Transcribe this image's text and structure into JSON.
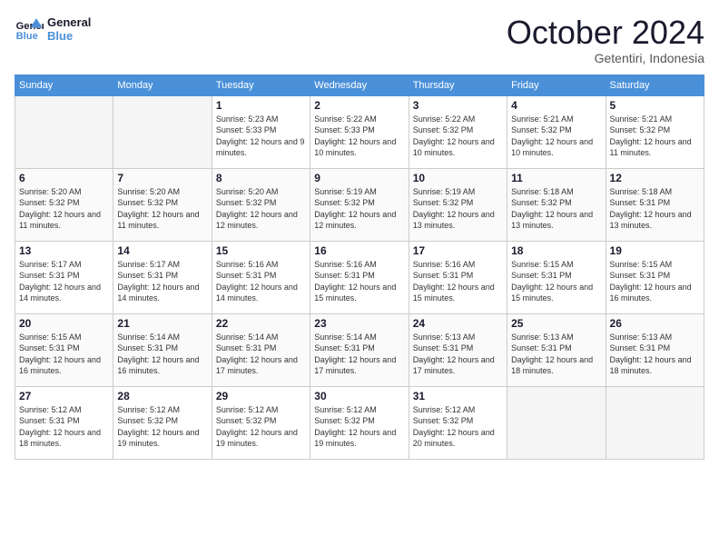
{
  "logo": {
    "text_general": "General",
    "text_blue": "Blue"
  },
  "header": {
    "month": "October 2024",
    "location": "Getentiri, Indonesia"
  },
  "weekdays": [
    "Sunday",
    "Monday",
    "Tuesday",
    "Wednesday",
    "Thursday",
    "Friday",
    "Saturday"
  ],
  "weeks": [
    [
      {
        "day": "",
        "empty": true
      },
      {
        "day": "",
        "empty": true
      },
      {
        "day": "1",
        "sunrise": "5:23 AM",
        "sunset": "5:33 PM",
        "daylight": "12 hours and 9 minutes."
      },
      {
        "day": "2",
        "sunrise": "5:22 AM",
        "sunset": "5:33 PM",
        "daylight": "12 hours and 10 minutes."
      },
      {
        "day": "3",
        "sunrise": "5:22 AM",
        "sunset": "5:32 PM",
        "daylight": "12 hours and 10 minutes."
      },
      {
        "day": "4",
        "sunrise": "5:21 AM",
        "sunset": "5:32 PM",
        "daylight": "12 hours and 10 minutes."
      },
      {
        "day": "5",
        "sunrise": "5:21 AM",
        "sunset": "5:32 PM",
        "daylight": "12 hours and 11 minutes."
      }
    ],
    [
      {
        "day": "6",
        "sunrise": "5:20 AM",
        "sunset": "5:32 PM",
        "daylight": "12 hours and 11 minutes."
      },
      {
        "day": "7",
        "sunrise": "5:20 AM",
        "sunset": "5:32 PM",
        "daylight": "12 hours and 11 minutes."
      },
      {
        "day": "8",
        "sunrise": "5:20 AM",
        "sunset": "5:32 PM",
        "daylight": "12 hours and 12 minutes."
      },
      {
        "day": "9",
        "sunrise": "5:19 AM",
        "sunset": "5:32 PM",
        "daylight": "12 hours and 12 minutes."
      },
      {
        "day": "10",
        "sunrise": "5:19 AM",
        "sunset": "5:32 PM",
        "daylight": "12 hours and 13 minutes."
      },
      {
        "day": "11",
        "sunrise": "5:18 AM",
        "sunset": "5:32 PM",
        "daylight": "12 hours and 13 minutes."
      },
      {
        "day": "12",
        "sunrise": "5:18 AM",
        "sunset": "5:31 PM",
        "daylight": "12 hours and 13 minutes."
      }
    ],
    [
      {
        "day": "13",
        "sunrise": "5:17 AM",
        "sunset": "5:31 PM",
        "daylight": "12 hours and 14 minutes."
      },
      {
        "day": "14",
        "sunrise": "5:17 AM",
        "sunset": "5:31 PM",
        "daylight": "12 hours and 14 minutes."
      },
      {
        "day": "15",
        "sunrise": "5:16 AM",
        "sunset": "5:31 PM",
        "daylight": "12 hours and 14 minutes."
      },
      {
        "day": "16",
        "sunrise": "5:16 AM",
        "sunset": "5:31 PM",
        "daylight": "12 hours and 15 minutes."
      },
      {
        "day": "17",
        "sunrise": "5:16 AM",
        "sunset": "5:31 PM",
        "daylight": "12 hours and 15 minutes."
      },
      {
        "day": "18",
        "sunrise": "5:15 AM",
        "sunset": "5:31 PM",
        "daylight": "12 hours and 15 minutes."
      },
      {
        "day": "19",
        "sunrise": "5:15 AM",
        "sunset": "5:31 PM",
        "daylight": "12 hours and 16 minutes."
      }
    ],
    [
      {
        "day": "20",
        "sunrise": "5:15 AM",
        "sunset": "5:31 PM",
        "daylight": "12 hours and 16 minutes."
      },
      {
        "day": "21",
        "sunrise": "5:14 AM",
        "sunset": "5:31 PM",
        "daylight": "12 hours and 16 minutes."
      },
      {
        "day": "22",
        "sunrise": "5:14 AM",
        "sunset": "5:31 PM",
        "daylight": "12 hours and 17 minutes."
      },
      {
        "day": "23",
        "sunrise": "5:14 AM",
        "sunset": "5:31 PM",
        "daylight": "12 hours and 17 minutes."
      },
      {
        "day": "24",
        "sunrise": "5:13 AM",
        "sunset": "5:31 PM",
        "daylight": "12 hours and 17 minutes."
      },
      {
        "day": "25",
        "sunrise": "5:13 AM",
        "sunset": "5:31 PM",
        "daylight": "12 hours and 18 minutes."
      },
      {
        "day": "26",
        "sunrise": "5:13 AM",
        "sunset": "5:31 PM",
        "daylight": "12 hours and 18 minutes."
      }
    ],
    [
      {
        "day": "27",
        "sunrise": "5:12 AM",
        "sunset": "5:31 PM",
        "daylight": "12 hours and 18 minutes."
      },
      {
        "day": "28",
        "sunrise": "5:12 AM",
        "sunset": "5:32 PM",
        "daylight": "12 hours and 19 minutes."
      },
      {
        "day": "29",
        "sunrise": "5:12 AM",
        "sunset": "5:32 PM",
        "daylight": "12 hours and 19 minutes."
      },
      {
        "day": "30",
        "sunrise": "5:12 AM",
        "sunset": "5:32 PM",
        "daylight": "12 hours and 19 minutes."
      },
      {
        "day": "31",
        "sunrise": "5:12 AM",
        "sunset": "5:32 PM",
        "daylight": "12 hours and 20 minutes."
      },
      {
        "day": "",
        "empty": true
      },
      {
        "day": "",
        "empty": true
      }
    ]
  ]
}
